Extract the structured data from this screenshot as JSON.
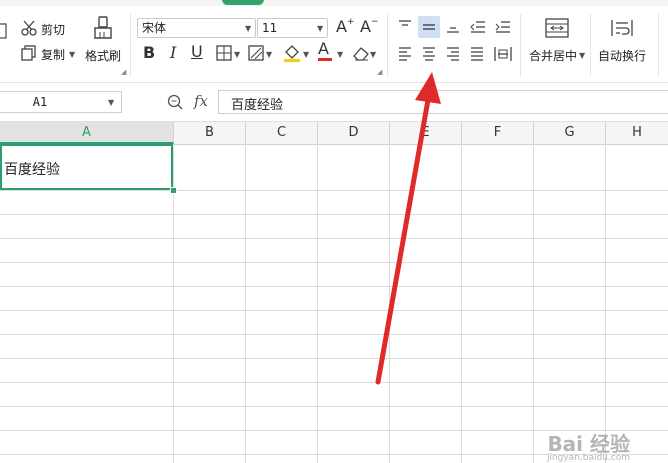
{
  "ribbon": {
    "cut_label": "剪切",
    "copy_label": "复制",
    "format_painter_label": "格式刷",
    "font_name": "宋体",
    "font_size": "11",
    "merge_center_label": "合并居中",
    "wrap_text_label": "自动换行"
  },
  "formula_bar": {
    "name_box": "A1",
    "fx_label": "fx",
    "content": "百度经验"
  },
  "sheet": {
    "columns": [
      "A",
      "B",
      "C",
      "D",
      "E",
      "F",
      "G",
      "H"
    ],
    "cell_a1": "百度经验",
    "selected_column": "A"
  },
  "watermark": {
    "brand": "Bai 经验",
    "url": "jingyan.baidu.com"
  },
  "colors": {
    "accent_green": "#2e9f6b",
    "arrow_red": "#e02a2a",
    "selected_button": "#cfe0f5"
  }
}
